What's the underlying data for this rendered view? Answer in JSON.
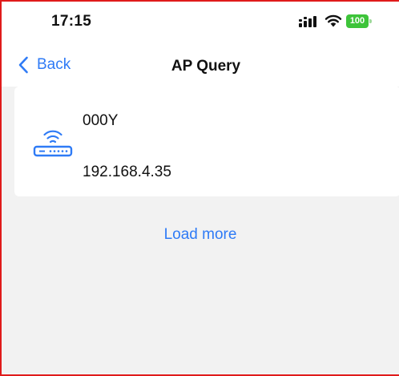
{
  "status_bar": {
    "time": "17:15",
    "signal_icon": "cellular-signal-icon",
    "wifi_icon": "wifi-icon",
    "battery_level": "100",
    "battery_color": "#3ec43a"
  },
  "nav": {
    "back_label": "Back",
    "back_icon": "chevron-left-icon",
    "title": "AP Query"
  },
  "ap_list": [
    {
      "icon": "wifi-router-icon",
      "name": "000Y",
      "ip": "192.168.4.35"
    }
  ],
  "load_more_label": "Load more",
  "colors": {
    "accent": "#2f7bf6",
    "background": "#f2f2f2"
  }
}
